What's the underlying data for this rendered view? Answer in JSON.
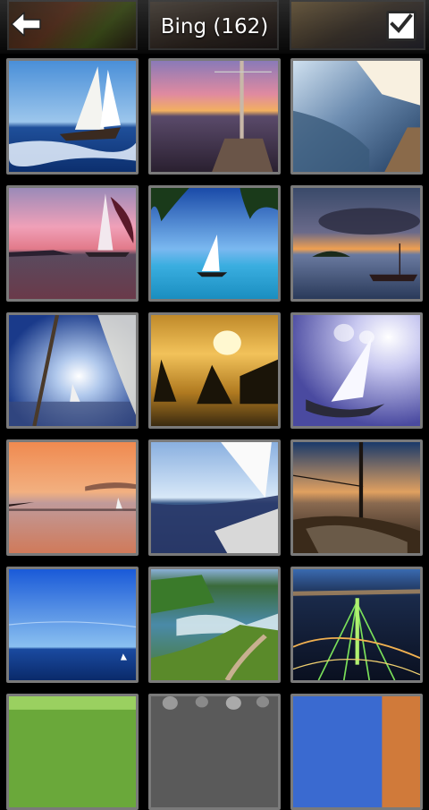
{
  "header": {
    "title": "Bing (162)",
    "back_icon": "arrow-left-icon",
    "select_icon": "checkbox-checked-icon"
  },
  "grid": {
    "images": [
      {
        "name": "photo-sailboat-waves"
      },
      {
        "name": "photo-sunset-deck"
      },
      {
        "name": "photo-sailing-spray"
      },
      {
        "name": "photo-pink-dusk-sail"
      },
      {
        "name": "photo-tropical-sailboat"
      },
      {
        "name": "photo-island-sunset"
      },
      {
        "name": "photo-mast-sunlight"
      },
      {
        "name": "photo-golden-sails"
      },
      {
        "name": "photo-backlit-regatta"
      },
      {
        "name": "photo-orange-sea-dusk"
      },
      {
        "name": "photo-heeling-yacht"
      },
      {
        "name": "photo-deck-sunset"
      },
      {
        "name": "photo-blue-sky-sea"
      },
      {
        "name": "photo-coastal-cliffs"
      },
      {
        "name": "photo-city-bridge-night"
      },
      {
        "name": "photo-partial-green"
      },
      {
        "name": "photo-partial-stones"
      },
      {
        "name": "photo-partial-red"
      }
    ]
  }
}
